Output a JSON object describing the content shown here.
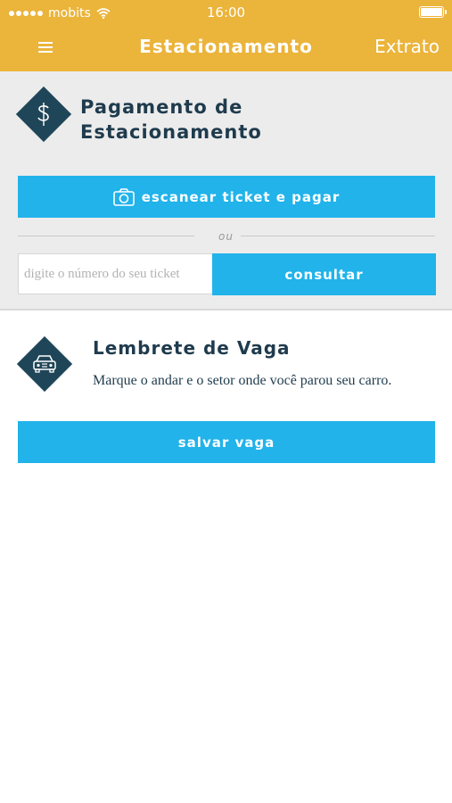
{
  "status_bar": {
    "carrier": "mobits",
    "time": "16:00"
  },
  "navbar": {
    "title": "Estacionamento",
    "right_action": "Extrato"
  },
  "payment": {
    "title_line1": "Pagamento de",
    "title_line2": "Estacionamento",
    "scan_button_label": "escanear ticket e pagar",
    "or_label": "ou",
    "ticket_placeholder": "digite o número do seu ticket",
    "consult_button_label": "consultar"
  },
  "reminder": {
    "title": "Lembrete de Vaga",
    "description": "Marque o andar e o setor onde você parou seu carro.",
    "save_button_label": "salvar vaga"
  },
  "colors": {
    "header": "#ebb43a",
    "accent": "#21b3ea",
    "dark": "#1f4658",
    "section_bg": "#ececec"
  },
  "icons": [
    "menu-icon",
    "dollar-icon",
    "camera-icon",
    "car-icon",
    "wifi-icon",
    "battery-icon"
  ]
}
